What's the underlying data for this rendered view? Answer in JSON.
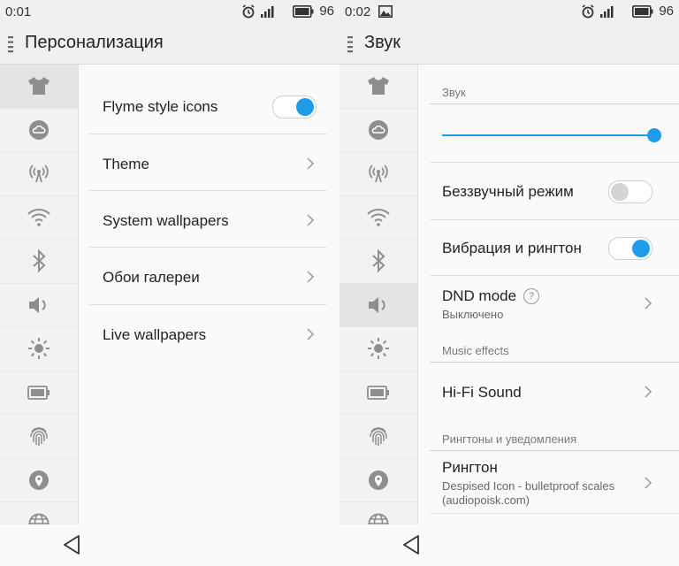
{
  "icon_color": "#8e8e8e",
  "accent": "#1e9be9",
  "left": {
    "status": {
      "time": "0:01",
      "battery": "96"
    },
    "title": "Персонализация",
    "rows": [
      {
        "label": "Flyme style icons",
        "type": "toggle",
        "on": true
      },
      {
        "label": "Theme",
        "type": "link"
      },
      {
        "label": "System wallpapers",
        "type": "link"
      },
      {
        "label": "Обои галереи",
        "type": "link"
      },
      {
        "label": "Live wallpapers",
        "type": "link"
      }
    ]
  },
  "right": {
    "status": {
      "time": "0:02",
      "battery": "96"
    },
    "title": "Звук",
    "section_sound": "Звук",
    "volume_level": 1.0,
    "silent_label": "Беззвучный режим",
    "silent_on": false,
    "vibration_label": "Вибрация и рингтон",
    "vibration_on": true,
    "dnd_label": "DND mode",
    "dnd_help": "?",
    "dnd_sub": "Выключено",
    "section_music": "Music effects",
    "hifi_label": "Hi-Fi Sound",
    "section_ring": "Рингтоны и уведомления",
    "ringtone_label": "Рингтон",
    "ringtone_sub1": "Despised Icon - bulletproof scales",
    "ringtone_sub2": "(audiopoisk.com)"
  },
  "sidebar_icons": [
    "tshirt-icon",
    "cloud-icon",
    "hotspot-icon",
    "wifi-icon",
    "bluetooth-icon",
    "speaker-icon",
    "brightness-icon",
    "battery-icon",
    "fingerprint-icon",
    "location-icon",
    "globe-icon"
  ]
}
